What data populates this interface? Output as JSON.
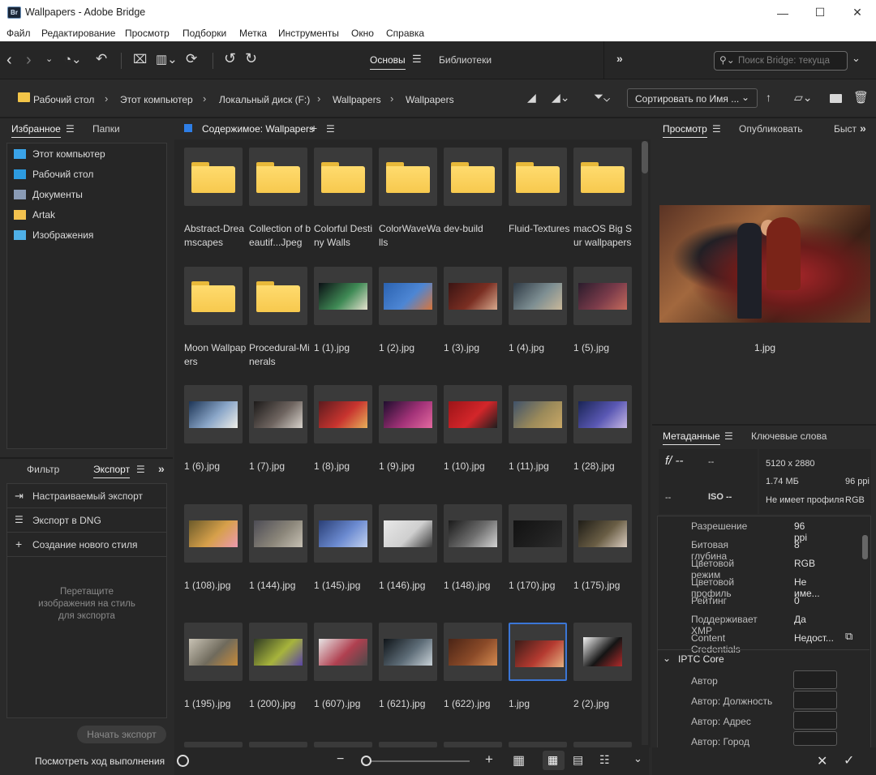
{
  "window": {
    "app_logo": "Br",
    "title": "Wallpapers - Adobe Bridge",
    "minimize": "—",
    "maximize": "☐",
    "close": "✕"
  },
  "menu": [
    "Файл",
    "Редактирование",
    "Просмотр",
    "Подборки",
    "Метка",
    "Инструменты",
    "Окно",
    "Справка"
  ],
  "toolbar": {
    "tab_basics": "Основы",
    "tab_libraries": "Библиотеки",
    "search_placeholder": "Поиск Bridge: текуща"
  },
  "breadcrumb": [
    "Рабочий стол",
    "Этот компьютер",
    "Локальный диск (F:)",
    "Wallpapers",
    "Wallpapers"
  ],
  "sort": {
    "label": "Сортировать по Имя ..."
  },
  "favorites_panel": {
    "tab_favorites": "Избранное",
    "tab_folders": "Папки",
    "items": [
      {
        "label": "Этот компьютер",
        "icon": "computer-icon",
        "color": "#3aa3e8"
      },
      {
        "label": "Рабочий стол",
        "icon": "desktop-icon",
        "color": "#2d9be0"
      },
      {
        "label": "Документы",
        "icon": "documents-icon",
        "color": "#8a9bb5"
      },
      {
        "label": "Artak",
        "icon": "folder-icon",
        "color": "#f2c14e"
      },
      {
        "label": "Изображения",
        "icon": "pictures-icon",
        "color": "#4fb0e8"
      }
    ]
  },
  "export_panel": {
    "tab_filter": "Фильтр",
    "tab_export": "Экспорт",
    "items": [
      {
        "label": "Настраиваемый экспорт",
        "icon": "export-icon"
      },
      {
        "label": "Экспорт в DNG",
        "icon": "list-icon"
      },
      {
        "label": "Создание нового стиля",
        "icon": "plus-icon"
      }
    ],
    "drop_hint": "Перетащите изображения на стиль для экспорта",
    "start_button": "Начать экспорт",
    "progress_link": "Посмотреть ход выполнения"
  },
  "content": {
    "title": "Содержимое: Wallpapers",
    "items": [
      {
        "name": "Abstract-Dreamscapes",
        "type": "folder"
      },
      {
        "name": "Collection of beautif...Jpeg",
        "type": "folder"
      },
      {
        "name": "Colorful Destiny Walls",
        "type": "folder"
      },
      {
        "name": "ColorWaveWalls",
        "type": "folder"
      },
      {
        "name": "dev-build",
        "type": "folder"
      },
      {
        "name": "Fluid-Textures",
        "type": "folder"
      },
      {
        "name": "macOS Big Sur wallpapers",
        "type": "folder"
      },
      {
        "name": "Moon Wallpapers",
        "type": "folder"
      },
      {
        "name": "Procedural-Minerals",
        "type": "folder"
      },
      {
        "name": "1 (1).jpg",
        "type": "image",
        "colors": [
          "#0b0f14",
          "#3f8a55",
          "#e6e2cf"
        ]
      },
      {
        "name": "1 (2).jpg",
        "type": "image",
        "colors": [
          "#2b62b0",
          "#4d86d4",
          "#d9753a"
        ]
      },
      {
        "name": "1 (3).jpg",
        "type": "image",
        "colors": [
          "#3a1413",
          "#7a2e22",
          "#d7a98d"
        ]
      },
      {
        "name": "1 (4).jpg",
        "type": "image",
        "colors": [
          "#2f3a45",
          "#7d8e92",
          "#c9b89a"
        ]
      },
      {
        "name": "1 (5).jpg",
        "type": "image",
        "colors": [
          "#2a1c2c",
          "#7a3b4a",
          "#c56a5c"
        ]
      },
      {
        "name": "1 (6).jpg",
        "type": "image",
        "colors": [
          "#1d3556",
          "#8aa6c8",
          "#f0f0ea"
        ]
      },
      {
        "name": "1 (7).jpg",
        "type": "image",
        "colors": [
          "#1c1a19",
          "#6f6560",
          "#d8d3cc"
        ]
      },
      {
        "name": "1 (8).jpg",
        "type": "image",
        "colors": [
          "#5b1b1e",
          "#c8342f",
          "#e7b05a"
        ]
      },
      {
        "name": "1 (9).jpg",
        "type": "image",
        "colors": [
          "#1f0d2e",
          "#a23278",
          "#e46aa0"
        ]
      },
      {
        "name": "1 (10).jpg",
        "type": "image",
        "colors": [
          "#9c1418",
          "#d3262a",
          "#1e1e1e"
        ]
      },
      {
        "name": "1 (11).jpg",
        "type": "image",
        "colors": [
          "#40526a",
          "#9b8a5a",
          "#c9a866"
        ]
      },
      {
        "name": "1 (28).jpg",
        "type": "image",
        "colors": [
          "#1a2555",
          "#5a58b4",
          "#c7b8e4"
        ]
      },
      {
        "name": "1 (108).jpg",
        "type": "image",
        "colors": [
          "#6b5a2a",
          "#d6a04a",
          "#ec9ab0"
        ]
      },
      {
        "name": "1 (144).jpg",
        "type": "image",
        "colors": [
          "#4d4c55",
          "#8a8579",
          "#c7c1b4"
        ]
      },
      {
        "name": "1 (145).jpg",
        "type": "image",
        "colors": [
          "#2a3f76",
          "#6b8ad0",
          "#c2d2f0"
        ]
      },
      {
        "name": "1 (146).jpg",
        "type": "image",
        "colors": [
          "#e8e8e8",
          "#cfcfcf",
          "#3a3a3a"
        ]
      },
      {
        "name": "1 (148).jpg",
        "type": "image",
        "colors": [
          "#1a1a1a",
          "#6f6f6f",
          "#d4d4d4"
        ]
      },
      {
        "name": "1 (170).jpg",
        "type": "image",
        "colors": [
          "#121212",
          "#1f1f1f",
          "#2c2c2c"
        ]
      },
      {
        "name": "1 (175).jpg",
        "type": "image",
        "colors": [
          "#1f1d17",
          "#6a5e45",
          "#d9ccc0"
        ]
      },
      {
        "name": "1 (195).jpg",
        "type": "image",
        "colors": [
          "#c9c3b5",
          "#6f6a5c",
          "#c58a3a"
        ]
      },
      {
        "name": "1 (200).jpg",
        "type": "image",
        "colors": [
          "#2f3a23",
          "#a7b43c",
          "#5a44a6"
        ]
      },
      {
        "name": "1 (607).jpg",
        "type": "image",
        "colors": [
          "#e7e5e5",
          "#b04050",
          "#4a4a4a"
        ]
      },
      {
        "name": "1 (621).jpg",
        "type": "image",
        "colors": [
          "#0f1418",
          "#5e6d78",
          "#c9d2d8"
        ]
      },
      {
        "name": "1 (622).jpg",
        "type": "image",
        "colors": [
          "#4a2416",
          "#8a4a28",
          "#d48a50"
        ]
      },
      {
        "name": "1.jpg",
        "type": "image",
        "selected": true,
        "colors": [
          "#3a1c18",
          "#b53a30",
          "#e5b080"
        ]
      },
      {
        "name": "2 (2).jpg",
        "type": "image",
        "colors": [
          "#f3f3f3",
          "#141414",
          "#b02a2a"
        ]
      }
    ]
  },
  "preview": {
    "tab_preview": "Просмотр",
    "tab_publish": "Опубликовать",
    "tab_quick": "Быст",
    "filename": "1.jpg"
  },
  "metadata": {
    "tab_metadata": "Метаданные",
    "tab_keywords": "Ключевые слова",
    "summary": {
      "f": "f/ --",
      "exposure": "--",
      "dash1": "--",
      "iso": "ISO --",
      "dimensions": "5120 x 2880",
      "size": "1.74 МБ",
      "ppi": "96 ppi",
      "profile": "Не имеет профиля",
      "mode": "RGB"
    },
    "rows": [
      {
        "key": "Разрешение",
        "value": "96 ppi"
      },
      {
        "key": "Битовая глубина",
        "value": "8"
      },
      {
        "key": "Цветовой режим",
        "value": "RGB"
      },
      {
        "key": "Цветовой профиль",
        "value": "Не име..."
      },
      {
        "key": "Рейтинг",
        "value": "0"
      },
      {
        "key": "Поддерживает XMP",
        "value": "Да"
      },
      {
        "key": "Content Credentials",
        "value": "Недост..."
      }
    ],
    "iptc_title": "IPTC Core",
    "iptc_rows": [
      {
        "key": "Автор"
      },
      {
        "key": "Автор: Должность"
      },
      {
        "key": "Автор: Адрес"
      },
      {
        "key": "Автор: Город"
      }
    ]
  }
}
